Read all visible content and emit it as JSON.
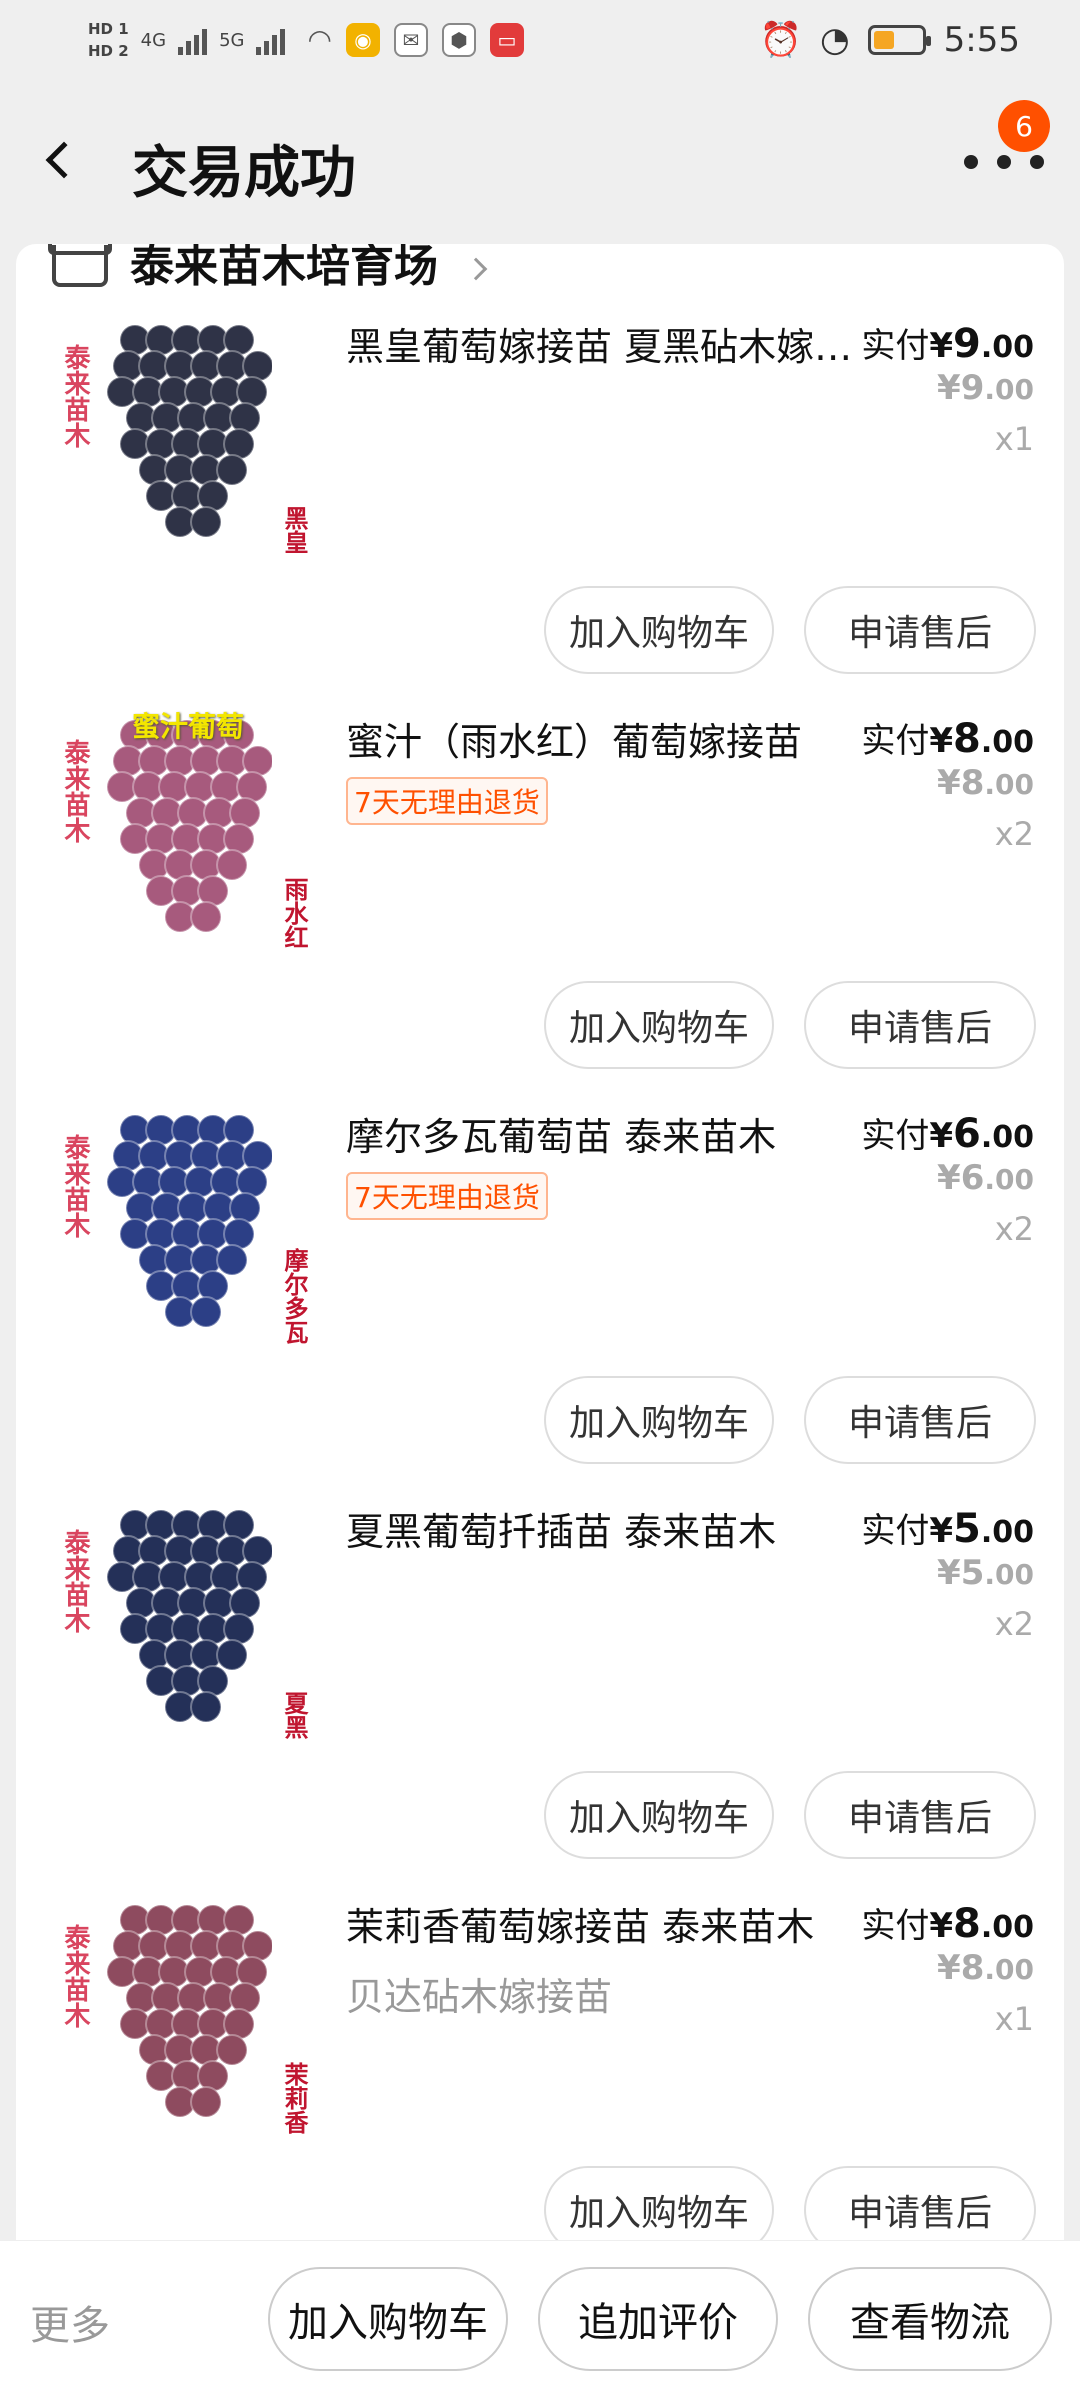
{
  "status_bar": {
    "hd1": "HD 1",
    "hd2": "HD 2",
    "net1": "4G",
    "net2": "5G",
    "time": "5:55"
  },
  "header": {
    "title": "交易成功",
    "badge_count": "6"
  },
  "shop": {
    "name": "泰来苗木培育场"
  },
  "items": [
    {
      "name": "黑皇葡萄嫁接苗  夏黑砧木嫁接苗",
      "promo": "",
      "sub": "",
      "paid_label": "实付",
      "paid_symbol": "¥",
      "paid_int": "9",
      "paid_dec": ".00",
      "orig_symbol": "¥",
      "orig_int": "9",
      "orig_dec": ".00",
      "qty": "x1",
      "img_brand": "泰来苗木",
      "img_tag": "黑皇",
      "img_toptag": "",
      "grape_color": "#2f3347",
      "add_cart": "加入购物车",
      "after_sale": "申请售后"
    },
    {
      "name": "蜜汁（雨水红）葡萄嫁接苗",
      "promo": "7天无理由退货",
      "sub": "",
      "paid_label": "实付",
      "paid_symbol": "¥",
      "paid_int": "8",
      "paid_dec": ".00",
      "orig_symbol": "¥",
      "orig_int": "8",
      "orig_dec": ".00",
      "qty": "x2",
      "img_brand": "泰来苗木",
      "img_tag": "雨水红",
      "img_toptag": "蜜汁葡萄",
      "grape_color": "#a75a7d",
      "add_cart": "加入购物车",
      "after_sale": "申请售后"
    },
    {
      "name": "摩尔多瓦葡萄苗  泰来苗木",
      "promo": "7天无理由退货",
      "sub": "",
      "paid_label": "实付",
      "paid_symbol": "¥",
      "paid_int": "6",
      "paid_dec": ".00",
      "orig_symbol": "¥",
      "orig_int": "6",
      "orig_dec": ".00",
      "qty": "x2",
      "img_brand": "泰来苗木",
      "img_tag": "摩尔多瓦",
      "img_toptag": "",
      "grape_color": "#2c3f86",
      "add_cart": "加入购物车",
      "after_sale": "申请售后"
    },
    {
      "name": "夏黑葡萄扦插苗    泰来苗木",
      "promo": "",
      "sub": "",
      "paid_label": "实付",
      "paid_symbol": "¥",
      "paid_int": "5",
      "paid_dec": ".00",
      "orig_symbol": "¥",
      "orig_int": "5",
      "orig_dec": ".00",
      "qty": "x2",
      "img_brand": "泰来苗木",
      "img_tag": "夏黑",
      "img_toptag": "",
      "grape_color": "#243058",
      "add_cart": "加入购物车",
      "after_sale": "申请售后"
    },
    {
      "name": "茉莉香葡萄嫁接苗 泰来苗木",
      "promo": "",
      "sub": "贝达砧木嫁接苗",
      "paid_label": "实付",
      "paid_symbol": "¥",
      "paid_int": "8",
      "paid_dec": ".00",
      "orig_symbol": "¥",
      "orig_int": "8",
      "orig_dec": ".00",
      "qty": "x1",
      "img_brand": "泰来苗木",
      "img_tag": "茉莉香",
      "img_toptag": "",
      "grape_color": "#8e4b5f",
      "add_cart": "加入购物车",
      "after_sale": "申请售后"
    }
  ],
  "bottom_bar": {
    "more": "更多",
    "add_cart": "加入购物车",
    "add_review": "追加评价",
    "view_logistics": "查看物流"
  }
}
